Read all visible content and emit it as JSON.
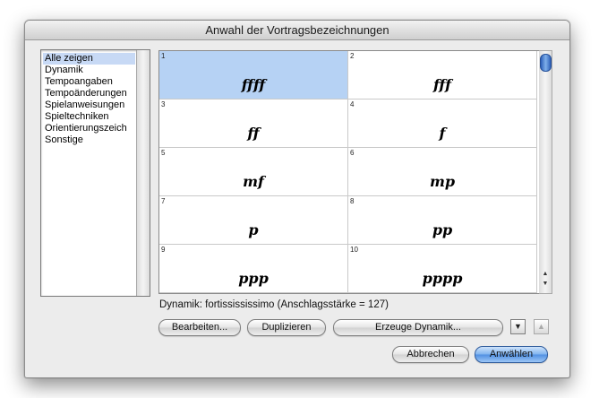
{
  "window": {
    "title": "Anwahl der Vortragsbezeichnungen"
  },
  "categories": [
    {
      "label": "Alle zeigen",
      "selected": true
    },
    {
      "label": "Dynamik",
      "selected": false
    },
    {
      "label": "Tempoangaben",
      "selected": false
    },
    {
      "label": "Tempoänderungen",
      "selected": false
    },
    {
      "label": "Spielanweisungen",
      "selected": false
    },
    {
      "label": "Spieltechniken",
      "selected": false
    },
    {
      "label": "Orientierungszeich",
      "selected": false
    },
    {
      "label": "Sonstige",
      "selected": false
    }
  ],
  "grid": {
    "cells": [
      {
        "num": "1",
        "symbol": "ffff",
        "selected": true
      },
      {
        "num": "2",
        "symbol": "fff",
        "selected": false
      },
      {
        "num": "3",
        "symbol": "ff",
        "selected": false
      },
      {
        "num": "4",
        "symbol": "f",
        "selected": false
      },
      {
        "num": "5",
        "symbol": "mf",
        "selected": false
      },
      {
        "num": "6",
        "symbol": "mp",
        "selected": false
      },
      {
        "num": "7",
        "symbol": "p",
        "selected": false
      },
      {
        "num": "8",
        "symbol": "pp",
        "selected": false
      },
      {
        "num": "9",
        "symbol": "ppp",
        "selected": false
      },
      {
        "num": "10",
        "symbol": "pppp",
        "selected": false
      }
    ]
  },
  "status": "Dynamik: fortissississimo (Anschlagsstärke = 127)",
  "buttons": {
    "edit": "Bearbeiten...",
    "duplicate": "Duplizieren",
    "create_dynamic": "Erzeuge Dynamik...",
    "cancel": "Abbrechen",
    "select": "Anwählen"
  },
  "icons": {
    "move_down": "chevron-down-icon",
    "move_up": "chevron-up-icon"
  },
  "colors": {
    "selection": "#b6d2f4",
    "default_button": "#4f8fe2"
  }
}
